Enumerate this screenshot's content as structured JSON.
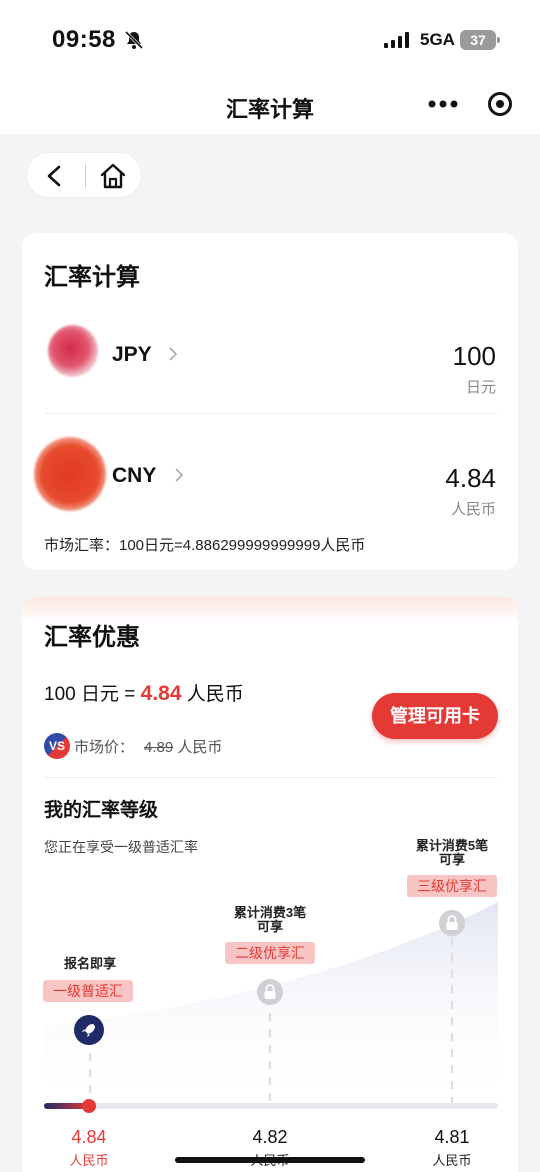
{
  "status": {
    "time": "09:58",
    "network": "5GA",
    "battery": "37"
  },
  "nav": {
    "title": "汇率计算",
    "more_icon": "more-dots-icon",
    "target_icon": "target-icon"
  },
  "converter": {
    "title": "汇率计算",
    "from": {
      "code": "JPY",
      "amount": "100",
      "unit": "日元"
    },
    "to": {
      "code": "CNY",
      "amount": "4.84",
      "unit": "人民币"
    },
    "market_rate": "市场汇率：100日元=4.886299999999999人民币"
  },
  "promo": {
    "title": "汇率优惠",
    "line_prefix": "100 日元 = ",
    "line_value": "4.84",
    "line_suffix": " 人民币",
    "vs_label": "VS",
    "market_price_label": "市场价：",
    "market_price_value": "4.89",
    "market_price_unit": " 人民币",
    "manage_button": "管理可用卡",
    "accent_color": "#e53935"
  },
  "levels": {
    "title": "我的汇率等级",
    "subtitle": "您正在享受一级普适汇率",
    "tiers": [
      {
        "note": "报名即享",
        "badge": "一级普适汇",
        "rate": "4.84",
        "unit": "人民币",
        "state": "active",
        "icon": "rocket-icon"
      },
      {
        "note_line1": "累计消费3笔",
        "note_line2": "可享",
        "badge": "二级优享汇",
        "rate": "4.82",
        "unit": "人民币",
        "state": "locked",
        "icon": "lock-icon"
      },
      {
        "note_line1": "累计消费5笔",
        "note_line2": "可享",
        "badge": "三级优享汇",
        "rate": "4.81",
        "unit": "人民币",
        "state": "locked",
        "icon": "lock-icon"
      }
    ],
    "progress": 0.1
  }
}
